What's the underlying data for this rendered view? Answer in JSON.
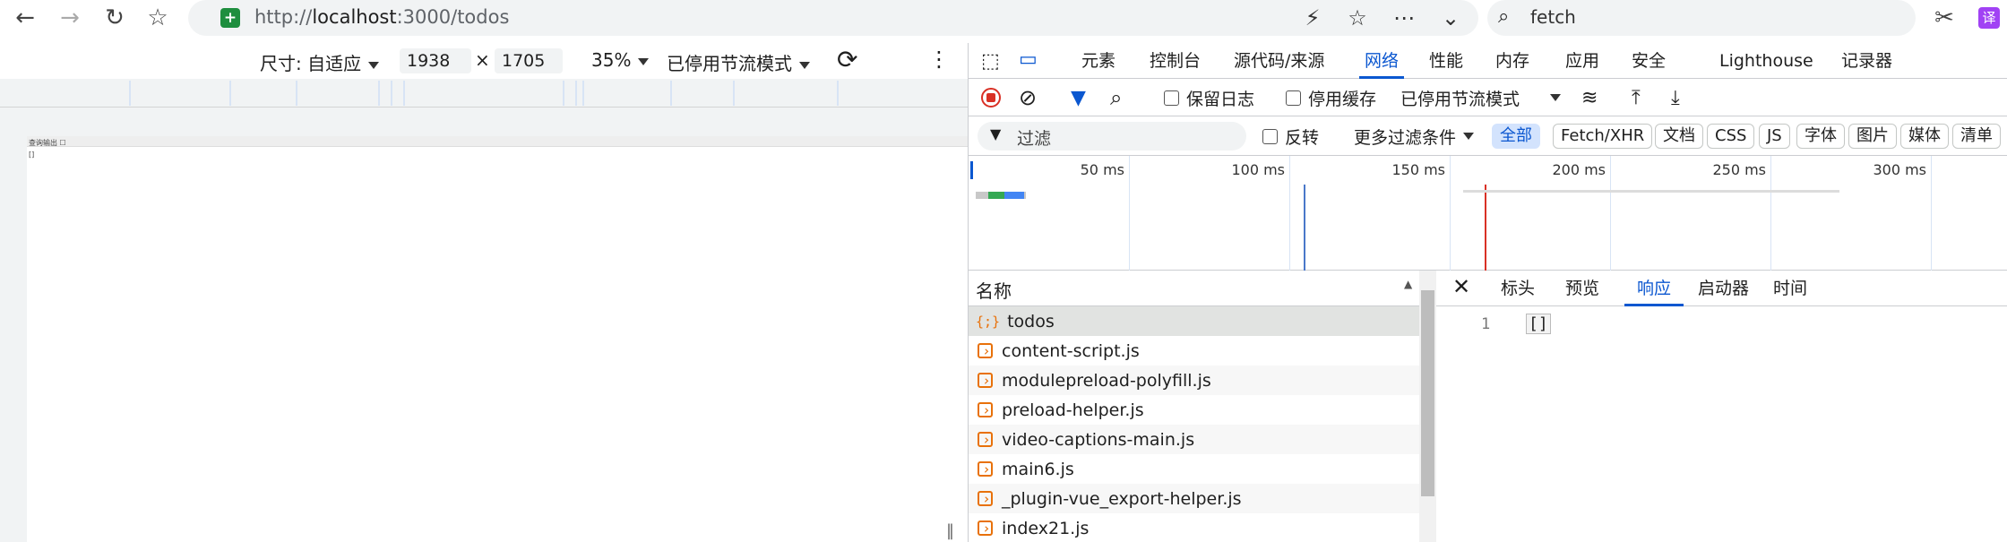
{
  "browser": {
    "url_scheme": "http://",
    "url_host": "localhost",
    "url_path": ":3000/todos",
    "find_text": "fetch",
    "translate_badge": "译"
  },
  "device_toolbar": {
    "size_label": "尺寸: 自适应",
    "width": "1938",
    "times": "×",
    "height": "1705",
    "zoom": "35%",
    "throttle": "已停用节流模式"
  },
  "viewport": {
    "mini_title": "查询输出 ☐",
    "mini_text": "[]"
  },
  "devtools": {
    "tabs": [
      "元素",
      "控制台",
      "源代码/来源",
      "网络",
      "性能",
      "内存",
      "应用",
      "安全",
      "Lighthouse",
      "记录器"
    ],
    "active_tab": "网络",
    "toolbar": {
      "preserve_log": "保留日志",
      "disable_cache": "停用缓存",
      "throttle": "已停用节流模式"
    },
    "filter": {
      "placeholder": "过滤",
      "invert": "反转",
      "more_filters": "更多过滤条件",
      "types": [
        "全部",
        "Fetch/XHR",
        "文档",
        "CSS",
        "JS",
        "字体",
        "图片",
        "媒体",
        "清单"
      ]
    },
    "timeline": {
      "labels": [
        "50 ms",
        "100 ms",
        "150 ms",
        "200 ms",
        "250 ms",
        "300 ms"
      ]
    },
    "requests": {
      "header": "名称",
      "rows": [
        "todos",
        "content-script.js",
        "modulepreload-polyfill.js",
        "preload-helper.js",
        "video-captions-main.js",
        "main6.js",
        "_plugin-vue_export-helper.js",
        "index21.js"
      ],
      "selected": "todos"
    },
    "detail": {
      "tabs": [
        "标头",
        "预览",
        "响应",
        "启动器",
        "时间"
      ],
      "active_tab": "响应",
      "line_number": "1",
      "content": "[]"
    }
  },
  "colors": {
    "accent": "#0b57d0",
    "record_red": "#d93025",
    "file_orange": "#e8710a"
  }
}
